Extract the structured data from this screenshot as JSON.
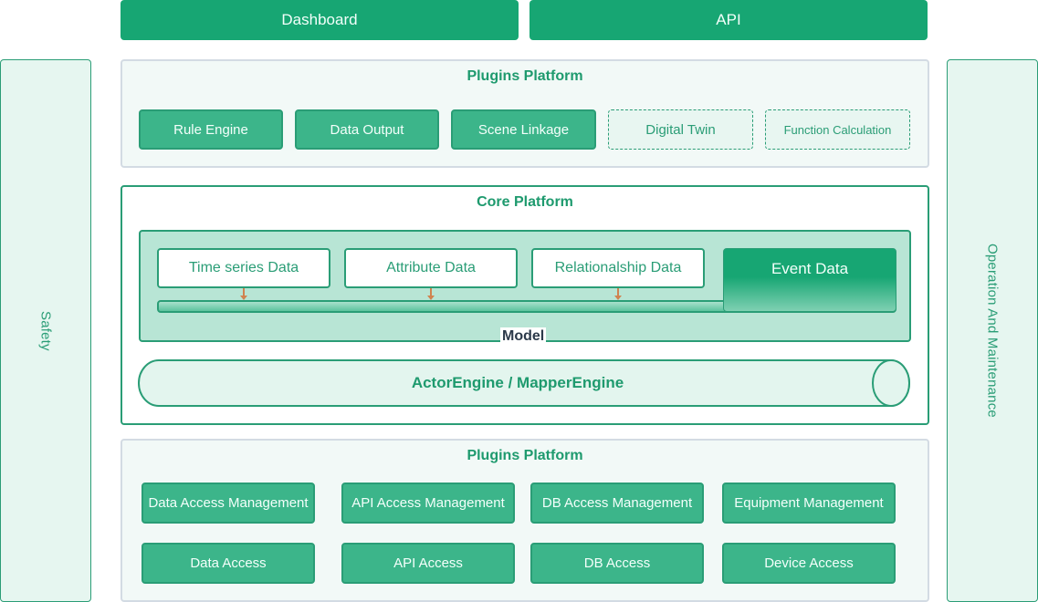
{
  "top": {
    "dashboard_label": "Dashboard",
    "api_label": "API"
  },
  "sides": {
    "left_label": "Safety",
    "right_label": "Operation And Maintenance"
  },
  "plugins_top": {
    "title": "Plugins Platform",
    "items": [
      {
        "label": "Rule Engine",
        "style": "solid"
      },
      {
        "label": "Data Output",
        "style": "solid"
      },
      {
        "label": "Scene Linkage",
        "style": "solid"
      },
      {
        "label": "Digital Twin",
        "style": "dashed"
      },
      {
        "label": "Function Calculation",
        "style": "dashed"
      }
    ]
  },
  "core": {
    "title": "Core Platform",
    "model_label": "Model",
    "data_types": [
      "Time series Data",
      "Attribute Data",
      "Relationalship Data",
      "Event Data"
    ],
    "engine_label": "ActorEngine / MapperEngine"
  },
  "plugins_bottom": {
    "title": "Plugins Platform",
    "management": [
      "Data Access Management",
      "API Access Management",
      "DB Access Management",
      "Equipment Management"
    ],
    "access": [
      "Data Access",
      "API Access",
      "DB Access",
      "Device Access"
    ]
  },
  "colors": {
    "primary": "#17a673",
    "button": "#3cb58a",
    "border": "#2a9d76",
    "model_bg": "#b8e5d5",
    "panel_bg": "#f2f9f7",
    "arrow": "#d08350",
    "model_text": "#2c3a4a"
  }
}
